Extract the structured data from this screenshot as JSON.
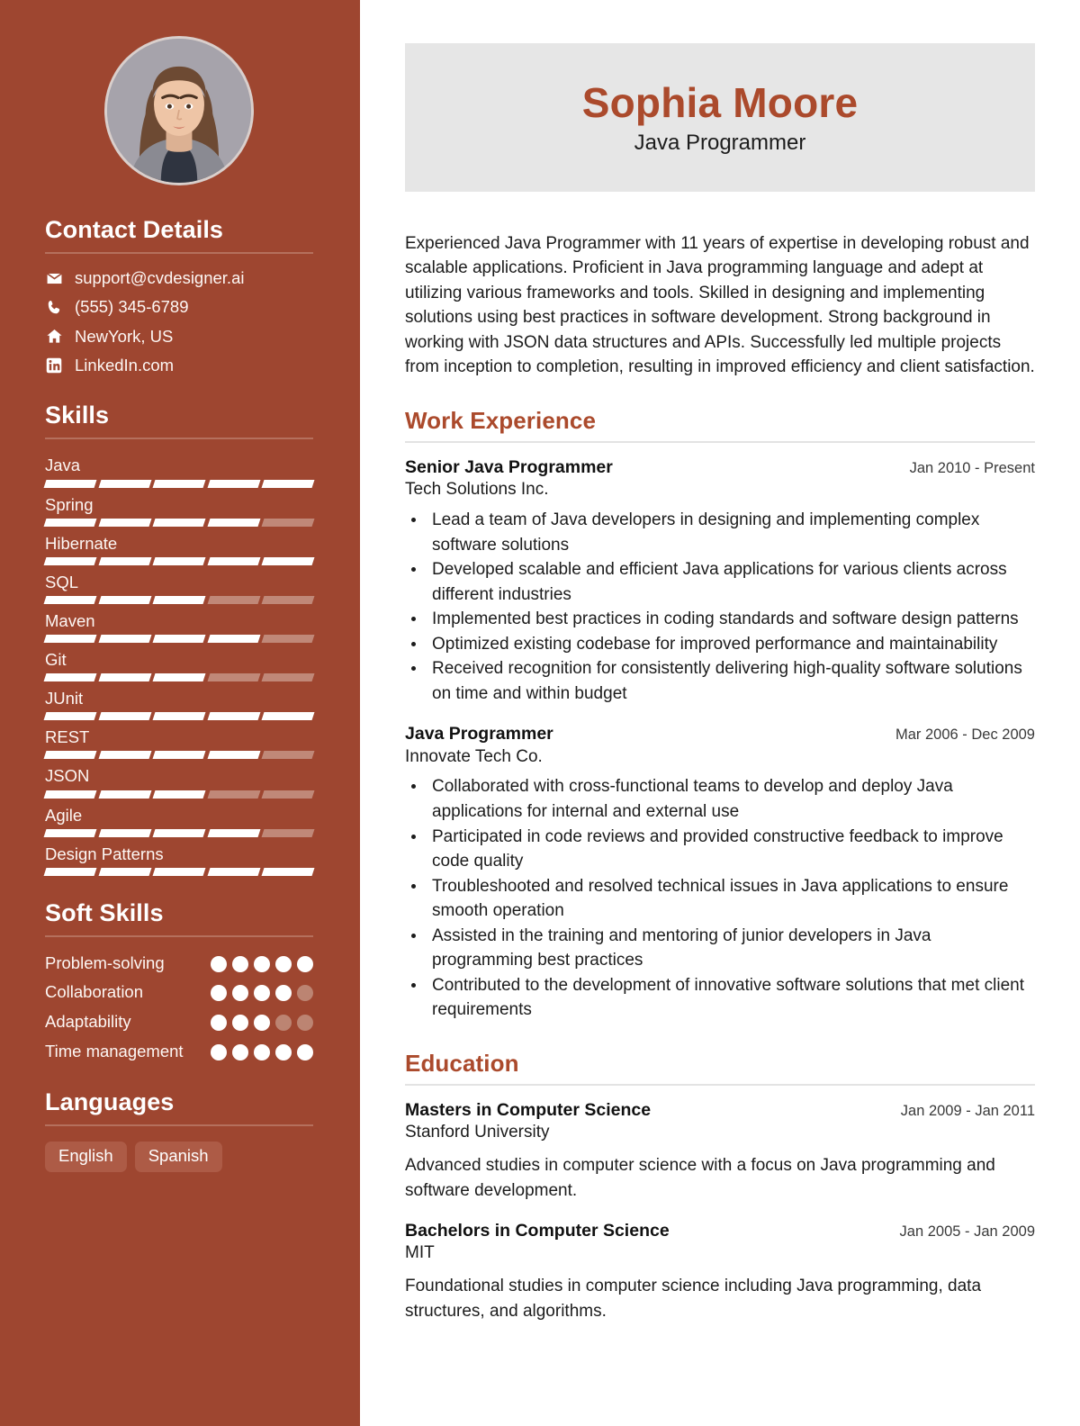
{
  "sidebar": {
    "photo": {
      "alt": "profile-photo"
    },
    "contact": {
      "heading": "Contact Details",
      "items": [
        {
          "icon": "email-icon",
          "text": "support@cvdesigner.ai"
        },
        {
          "icon": "phone-icon",
          "text": "(555) 345-6789"
        },
        {
          "icon": "home-icon",
          "text": "NewYork, US"
        },
        {
          "icon": "linkedin-icon",
          "text": "LinkedIn.com"
        }
      ]
    },
    "skills": {
      "heading": "Skills",
      "max": 5,
      "items": [
        {
          "name": "Java",
          "level": 5
        },
        {
          "name": "Spring",
          "level": 4
        },
        {
          "name": "Hibernate",
          "level": 5
        },
        {
          "name": "SQL",
          "level": 3
        },
        {
          "name": "Maven",
          "level": 4
        },
        {
          "name": "Git",
          "level": 3
        },
        {
          "name": "JUnit",
          "level": 5
        },
        {
          "name": "REST",
          "level": 4
        },
        {
          "name": "JSON",
          "level": 3
        },
        {
          "name": "Agile",
          "level": 4
        },
        {
          "name": "Design Patterns",
          "level": 5
        }
      ]
    },
    "soft_skills": {
      "heading": "Soft Skills",
      "max": 5,
      "items": [
        {
          "name": "Problem-solving",
          "level": 5
        },
        {
          "name": "Collaboration",
          "level": 4
        },
        {
          "name": "Adaptability",
          "level": 3
        },
        {
          "name": "Time management",
          "level": 5
        }
      ]
    },
    "languages": {
      "heading": "Languages",
      "items": [
        "English",
        "Spanish"
      ]
    }
  },
  "main": {
    "name": "Sophia Moore",
    "role": "Java Programmer",
    "summary": "Experienced Java Programmer with 11 years of expertise in developing robust and scalable applications. Proficient in Java programming language and adept at utilizing various frameworks and tools. Skilled in designing and implementing solutions using best practices in software development. Strong background in working with JSON data structures and APIs. Successfully led multiple projects from inception to completion, resulting in improved efficiency and client satisfaction.",
    "work": {
      "heading": "Work Experience",
      "entries": [
        {
          "title": "Senior Java Programmer",
          "org": "Tech Solutions Inc.",
          "date": "Jan 2010 - Present",
          "bullets": [
            "Lead a team of Java developers in designing and implementing complex software solutions",
            "Developed scalable and efficient Java applications for various clients across different industries",
            "Implemented best practices in coding standards and software design patterns",
            "Optimized existing codebase for improved performance and maintainability",
            "Received recognition for consistently delivering high-quality software solutions on time and within budget"
          ]
        },
        {
          "title": "Java Programmer",
          "org": "Innovate Tech Co.",
          "date": "Mar 2006 - Dec 2009",
          "bullets": [
            "Collaborated with cross-functional teams to develop and deploy Java applications for internal and external use",
            "Participated in code reviews and provided constructive feedback to improve code quality",
            "Troubleshooted and resolved technical issues in Java applications to ensure smooth operation",
            "Assisted in the training and mentoring of junior developers in Java programming best practices",
            "Contributed to the development of innovative software solutions that met client requirements"
          ]
        }
      ]
    },
    "education": {
      "heading": "Education",
      "entries": [
        {
          "title": "Masters in Computer Science",
          "org": "Stanford University",
          "date": "Jan 2009 - Jan 2011",
          "desc": "Advanced studies in computer science with a focus on Java programming and software development."
        },
        {
          "title": "Bachelors in Computer Science",
          "org": "MIT",
          "date": "Jan 2005 - Jan 2009",
          "desc": "Foundational studies in computer science including Java programming, data structures, and algorithms."
        }
      ]
    }
  },
  "colors": {
    "sidebar_bg": "#9e4630",
    "accent": "#ab4a2c",
    "namecard_bg": "#e6e6e6",
    "bar_on": "#ffffff",
    "bar_off": "#c08878"
  }
}
